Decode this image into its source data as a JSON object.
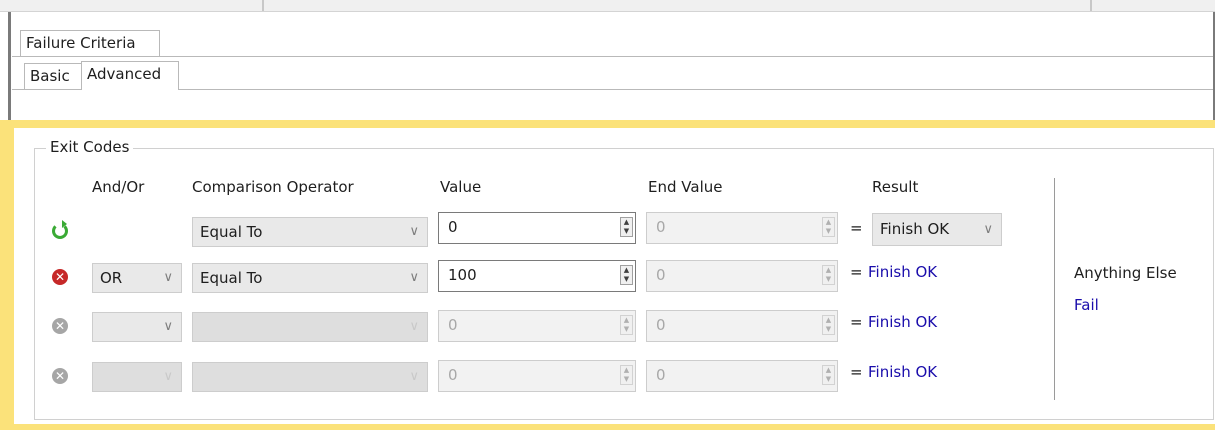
{
  "tabs": {
    "top": "Failure Criteria",
    "sub": [
      "Basic",
      "Advanced"
    ]
  },
  "group_title": "Exit Codes",
  "columns": {
    "and_or": "And/Or",
    "operator": "Comparison Operator",
    "value": "Value",
    "end_value": "End Value",
    "result": "Result"
  },
  "rows": [
    {
      "and_or": "",
      "operator": "Equal To",
      "value": "0",
      "end_value": "0",
      "result": "Finish OK"
    },
    {
      "and_or": "OR",
      "operator": "Equal To",
      "value": "100",
      "end_value": "0",
      "result": "Finish OK"
    },
    {
      "and_or": "",
      "operator": "",
      "value": "0",
      "end_value": "0",
      "result": "Finish OK"
    },
    {
      "and_or": "",
      "operator": "",
      "value": "0",
      "end_value": "0",
      "result": "Finish OK"
    }
  ],
  "equals_sign": "=",
  "anything_else": {
    "label": "Anything Else",
    "result": "Fail"
  },
  "icons": [
    "refresh-icon",
    "remove-icon",
    "remove-icon",
    "remove-icon"
  ],
  "colors": {
    "panel_highlight": "#fbe27a",
    "link": "#1a0dab",
    "remove": "#c62828",
    "add": "#3aaa35"
  }
}
